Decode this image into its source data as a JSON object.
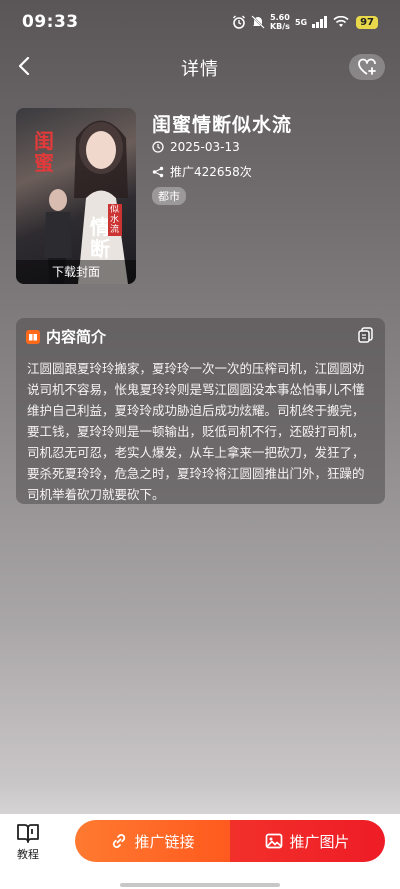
{
  "status": {
    "time": "09:33",
    "net_speed_value": "5.60",
    "net_speed_unit": "KB/s",
    "signal_label": "5G",
    "battery": "97"
  },
  "header": {
    "title": "详情"
  },
  "drama": {
    "title": "闺蜜情断似水流",
    "date": "2025-03-13",
    "promo_count": "推广422658次",
    "genre": "都市",
    "cover_download_label": "下载封面",
    "cover_text_left": "闺蜜",
    "cover_text_right": "情断",
    "cover_text_small": "似水流"
  },
  "intro": {
    "heading": "内容简介",
    "text": "江圆圆跟夏玲玲搬家，夏玲玲一次一次的压榨司机，江圆圆劝说司机不容易，怅鬼夏玲玲则是骂江圆圆没本事怂怕事儿不懂维护自己利益，夏玲玲成功胁迫后成功炫耀。司机终于搬完，要工钱，夏玲玲则是一顿输出，贬低司机不行，还殴打司机，司机忍无可忍，老实人爆发，从车上拿来一把砍刀，发狂了，要杀死夏玲玲，危急之时，夏玲玲将江圆圆推出门外，狂躁的司机举着砍刀就要砍下。"
  },
  "bottom": {
    "tutorial_label": "教程",
    "promo_link_label": "推广链接",
    "promo_image_label": "推广图片"
  },
  "colors": {
    "link_button": "#ff6a27",
    "image_button": "#ee1c26"
  }
}
